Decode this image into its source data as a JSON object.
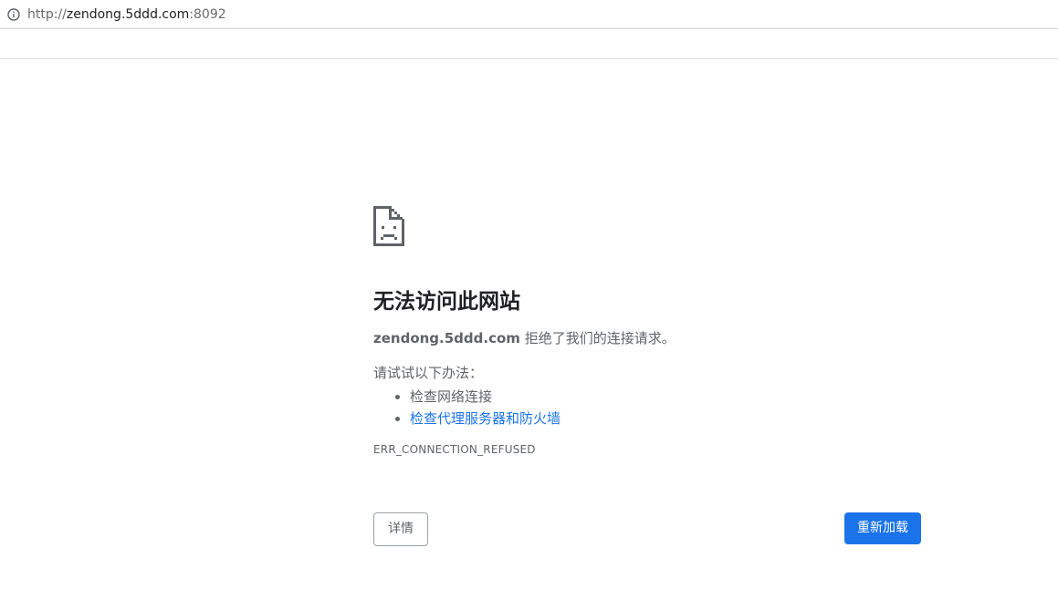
{
  "address_bar": {
    "scheme": "http://",
    "host": "zendong.5ddd.com",
    "port": ":8092",
    "info_icon": "info-circle-icon"
  },
  "error_page": {
    "icon": "sad-page-icon",
    "title": "无法访问此网站",
    "domain": "zendong.5ddd.com",
    "message": " 拒绝了我们的连接请求。",
    "suggestions_intro": "请试试以下办法：",
    "suggestions": [
      {
        "text": "检查网络连接",
        "is_link": false
      },
      {
        "text": "检查代理服务器和防火墙",
        "is_link": true
      }
    ],
    "error_code": "ERR_CONNECTION_REFUSED"
  },
  "buttons": {
    "details_label": "详情",
    "reload_label": "重新加载"
  },
  "colors": {
    "link": "#1a73e8",
    "primary_button": "#1a73e8",
    "text": "#5f6368",
    "title": "#202124"
  }
}
